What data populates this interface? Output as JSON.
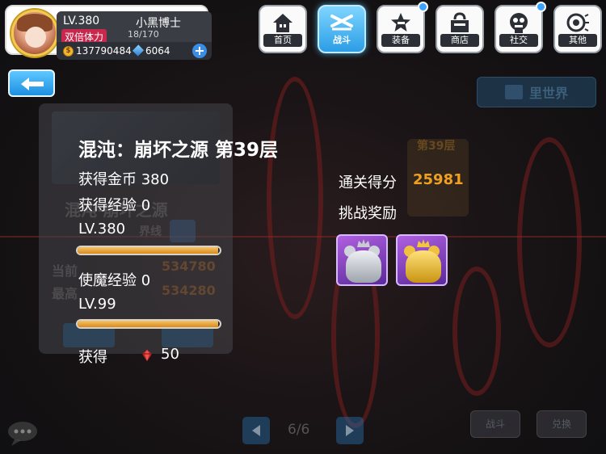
{
  "player": {
    "level": "LV.380",
    "name": "小黑博士",
    "stamina_label": "双倍体力",
    "stamina": "18/170",
    "stamina_fraction": 0.106,
    "coins": "137790484",
    "gems": "6064",
    "add_label": "+"
  },
  "nav": [
    {
      "label": "首页",
      "icon": "house-icon",
      "active": false,
      "badge": false
    },
    {
      "label": "战斗",
      "icon": "battle-icon",
      "active": true,
      "badge": false
    },
    {
      "label": "装备",
      "icon": "star-gun-icon",
      "active": false,
      "badge": true
    },
    {
      "label": "商店",
      "icon": "shop-icon",
      "active": false,
      "badge": false
    },
    {
      "label": "社交",
      "icon": "mascot-icon",
      "active": false,
      "badge": true
    },
    {
      "label": "其他",
      "icon": "speaker-icon",
      "active": false,
      "badge": false
    }
  ],
  "background": {
    "ura_button": "里世界",
    "floor_badge": "第39层",
    "faded_title_fragment": "混沌·崩坏之源",
    "faded_label": "当前",
    "faded_label2": "最高",
    "faded_val1": "534780",
    "faded_val2": "534280",
    "faded_boundary": "界线",
    "pager": "6/6",
    "bottom_btn_1": "战斗",
    "bottom_btn_2": "兑换"
  },
  "result": {
    "title": "混沌：崩坏之源 第39层",
    "gold_label": "获得金币",
    "gold_value": "380",
    "exp_label": "获得经验",
    "exp_value": "0",
    "player_level": "LV.380",
    "player_exp_fraction": 0.99,
    "familiar_exp_label": "使魔经验",
    "familiar_exp_value": "0",
    "familiar_level": "LV.99",
    "familiar_exp_fraction": 0.99,
    "score_label": "通关得分",
    "score_value": "25981",
    "reward_label": "挑战奖励",
    "rewards": [
      {
        "icon": "silver-bear-figure-icon"
      },
      {
        "icon": "gold-bear-figure-icon"
      }
    ],
    "obtain_label": "获得",
    "obtain_item_icon": "red-crystal-icon",
    "obtain_value": "50"
  },
  "colors": {
    "accent_blue": "#2b9de6",
    "score_orange": "#f0a020",
    "stamina_red": "#c8284e",
    "xp_bar": "#d88a1a"
  }
}
